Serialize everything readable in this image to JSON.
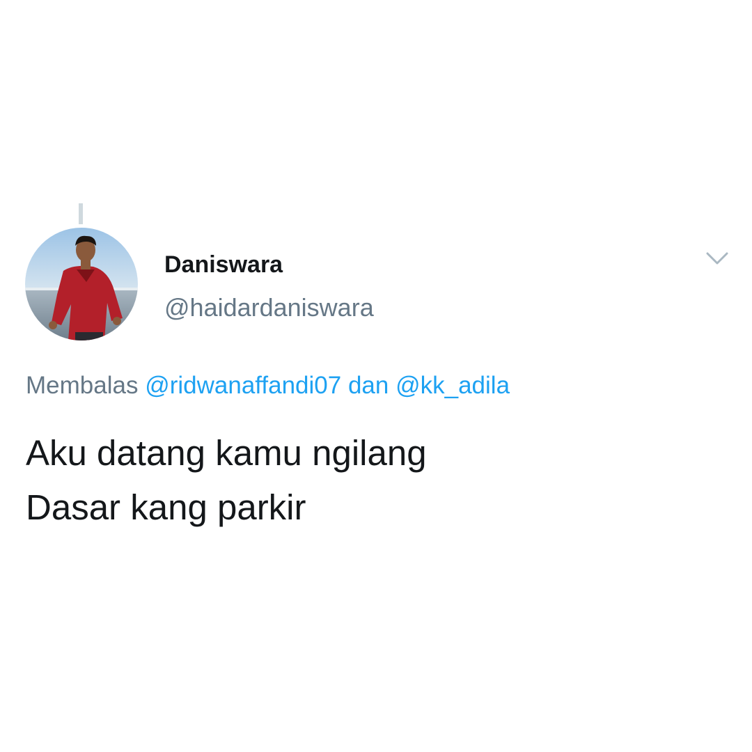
{
  "tweet": {
    "author": {
      "display_name": "Daniswara",
      "handle": "@haidardaniswara",
      "avatar_icon": "profile-photo"
    },
    "menu_icon": "chevron-down-icon",
    "reply": {
      "prefix": "Membalas",
      "mention_1": "@ridwanaffandi07",
      "conjunction": "dan",
      "mention_2": "@kk_adila"
    },
    "text_lines": [
      "Aku datang kamu ngilang",
      "Dasar kang parkir"
    ]
  },
  "colors": {
    "text_primary": "#14171a",
    "text_secondary": "#657786",
    "link": "#1da1f2",
    "thread_line": "#cfd9de"
  }
}
